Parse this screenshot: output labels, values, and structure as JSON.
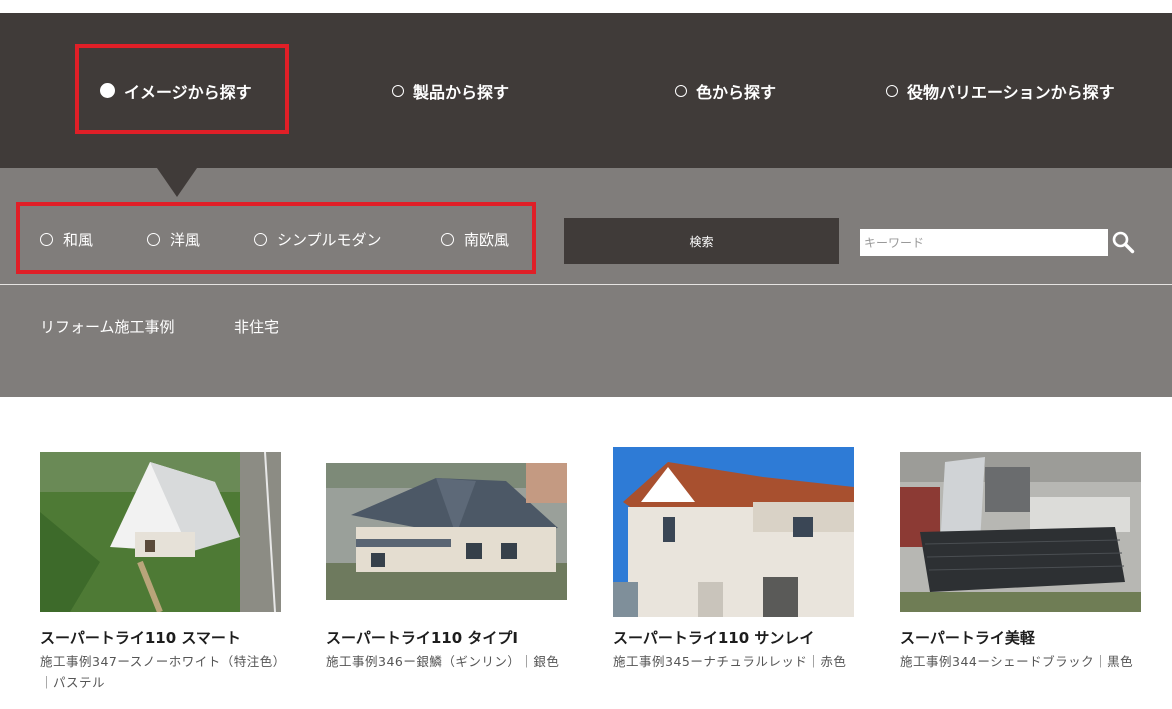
{
  "main_tabs": [
    {
      "label": "イメージから探す",
      "selected": true
    },
    {
      "label": "製品から探す",
      "selected": false
    },
    {
      "label": "色から探す",
      "selected": false
    },
    {
      "label": "役物バリエーションから探す",
      "selected": false
    }
  ],
  "style_options": [
    "和風",
    "洋風",
    "シンプルモダン",
    "南欧風"
  ],
  "search": {
    "button_label": "検索",
    "placeholder": "キーワード"
  },
  "category_links": [
    "リフォーム施工事例",
    "非住宅"
  ],
  "cards": [
    {
      "title": "スーパートライ110 スマート",
      "description": "施工事例347ースノーホワイト（特注色）｜パステル"
    },
    {
      "title": "スーパートライ110 タイプⅠ",
      "description": "施工事例346ー銀鱗（ギンリン）｜銀色"
    },
    {
      "title": "スーパートライ110 サンレイ",
      "description": "施工事例345ーナチュラルレッド｜赤色"
    },
    {
      "title": "スーパートライ美軽",
      "description": "施工事例344ーシェードブラック｜黒色"
    }
  ],
  "colors": {
    "header_bg": "#403b39",
    "panel_bg": "#807d7b",
    "highlight": "#e01f27",
    "text_light": "#ffffff",
    "title_text": "#1d1d1d"
  }
}
